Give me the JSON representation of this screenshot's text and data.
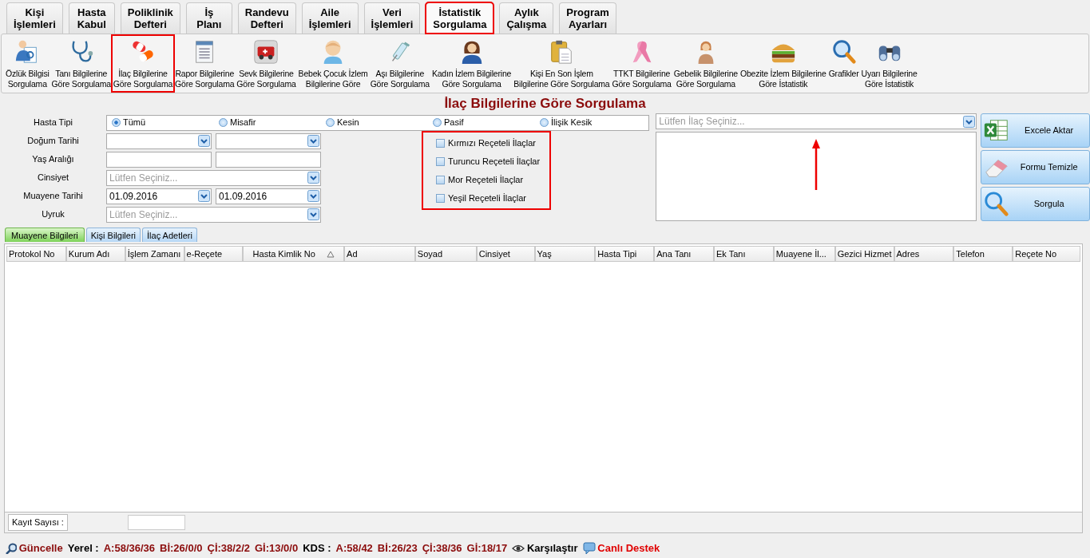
{
  "main_tabs": [
    {
      "label": "Kişi\nİşlemleri",
      "selected": false,
      "highlighted": false
    },
    {
      "label": "Hasta\nKabul",
      "selected": false,
      "highlighted": false
    },
    {
      "label": "Poliklinik\nDefteri",
      "selected": false,
      "highlighted": false
    },
    {
      "label": "İş\nPlanı",
      "selected": false,
      "highlighted": false
    },
    {
      "label": "Randevu\nDefteri",
      "selected": false,
      "highlighted": false
    },
    {
      "label": "Aile\nİşlemleri",
      "selected": false,
      "highlighted": false
    },
    {
      "label": "Veri\nİşlemleri",
      "selected": false,
      "highlighted": false
    },
    {
      "label": "İstatistik\nSorgulama",
      "selected": true,
      "highlighted": true
    },
    {
      "label": "Aylık\nÇalışma",
      "selected": false,
      "highlighted": false
    },
    {
      "label": "Program\nAyarları",
      "selected": false,
      "highlighted": false
    }
  ],
  "toolbar": [
    {
      "label": "Özlük Bilgisi\nSorgulama",
      "highlighted": false
    },
    {
      "label": "Tanı Bilgilerine\nGöre Sorgulama",
      "highlighted": false
    },
    {
      "label": "İlaç Bilgilerine\nGöre Sorgulama",
      "highlighted": true
    },
    {
      "label": "Rapor Bilgilerine\nGöre Sorgulama",
      "highlighted": false
    },
    {
      "label": "Sevk Bilgilerine\nGöre Sorgulama",
      "highlighted": false
    },
    {
      "label": "Bebek Çocuk İzlem\nBilgilerine Göre",
      "highlighted": false
    },
    {
      "label": "Aşı Bilgilerine\nGöre Sorgulama",
      "highlighted": false
    },
    {
      "label": "Kadın İzlem Bilgilerine\nGöre Sorgulama",
      "highlighted": false
    },
    {
      "label": "Kişi En Son İşlem\nBilgilerine Göre Sorgulama",
      "highlighted": false
    },
    {
      "label": "TTKT Bilgilerine\nGöre Sorgulama",
      "highlighted": false
    },
    {
      "label": "Gebelik Bilgilerine\nGöre Sorgulama",
      "highlighted": false
    },
    {
      "label": "Obezite İzlem Bilgilerine\nGöre İstatistik",
      "highlighted": false
    },
    {
      "label": "Grafikler",
      "highlighted": false
    },
    {
      "label": "Uyarı Bilgilerine\nGöre İstatistik",
      "highlighted": false
    }
  ],
  "page_title": "İlaç Bilgilerine Göre Sorgulama",
  "form": {
    "patient_type": {
      "label": "Hasta Tipi",
      "options": [
        {
          "label": "Tümü",
          "selected": true
        },
        {
          "label": "Misafir",
          "selected": false
        },
        {
          "label": "Kesin",
          "selected": false
        },
        {
          "label": "Pasif",
          "selected": false
        },
        {
          "label": "İlişik Kesik",
          "selected": false
        }
      ]
    },
    "rows": [
      {
        "label": "Doğum Tarihi",
        "kind": "empty_combo_pair"
      },
      {
        "label": "Yaş Aralığı",
        "kind": "empty_text_pair"
      },
      {
        "label": "Cinsiyet",
        "kind": "combo",
        "placeholder": "Lütfen Seçiniz..."
      },
      {
        "label": "Muayene Tarihi",
        "kind": "combo_pair",
        "values": [
          "01.09.2016",
          "01.09.2016"
        ]
      },
      {
        "label": "Uyruk",
        "kind": "combo",
        "placeholder": "Lütfen Seçiniz..."
      }
    ],
    "prescriptions": {
      "highlighted": true,
      "items": [
        {
          "label": "Kırmızı Reçeteli İlaçlar",
          "checked": false
        },
        {
          "label": "Turuncu Reçeteli İlaçlar",
          "checked": false
        },
        {
          "label": "Mor Reçeteli İlaçlar",
          "checked": false
        },
        {
          "label": "Yeşil Reçeteli İlaçlar",
          "checked": false
        }
      ]
    },
    "drug_select": {
      "placeholder": "Lütfen İlaç Seçiniz..."
    },
    "annotation_arrow": true
  },
  "actions": [
    "Excele Aktar",
    "Formu Temizle",
    "Sorgula"
  ],
  "sub_tabs": [
    {
      "label": "Muayene Bilgileri",
      "selected": true
    },
    {
      "label": "Kişi Bilgileri",
      "selected": false
    },
    {
      "label": "İlaç Adetleri",
      "selected": false
    }
  ],
  "table": {
    "columns": [
      {
        "label": "Protokol No"
      },
      {
        "label": "Kurum Adı"
      },
      {
        "label": "İşlem Zamanı"
      },
      {
        "label": "e-Reçete"
      },
      {
        "label": "Hasta Kimlik No",
        "sorted": true
      },
      {
        "label": "Ad"
      },
      {
        "label": "Soyad"
      },
      {
        "label": "Cinsiyet"
      },
      {
        "label": "Yaş"
      },
      {
        "label": "Hasta Tipi"
      },
      {
        "label": "Ana Tanı"
      },
      {
        "label": "Ek Tanı"
      },
      {
        "label": "Muayene İl..."
      },
      {
        "label": "Gezici Hizmet"
      },
      {
        "label": "Adres"
      },
      {
        "label": "Telefon"
      },
      {
        "label": "Reçete No"
      }
    ],
    "record_count_label": "Kayıt Sayısı :"
  },
  "status_bar": {
    "refresh": "Güncelle",
    "local_label": "Yerel :",
    "local_counts": [
      "A:58/36/36",
      "Bİ:26/0/0",
      "Çİ:38/2/2",
      "Gİ:13/0/0"
    ],
    "kds_label": "KDS :",
    "kds_counts": [
      "A:58/42",
      "Bİ:26/23",
      "Çİ:38/36",
      "Gİ:18/17"
    ],
    "compare": "Karşılaştır",
    "support": "Canlı Destek"
  }
}
